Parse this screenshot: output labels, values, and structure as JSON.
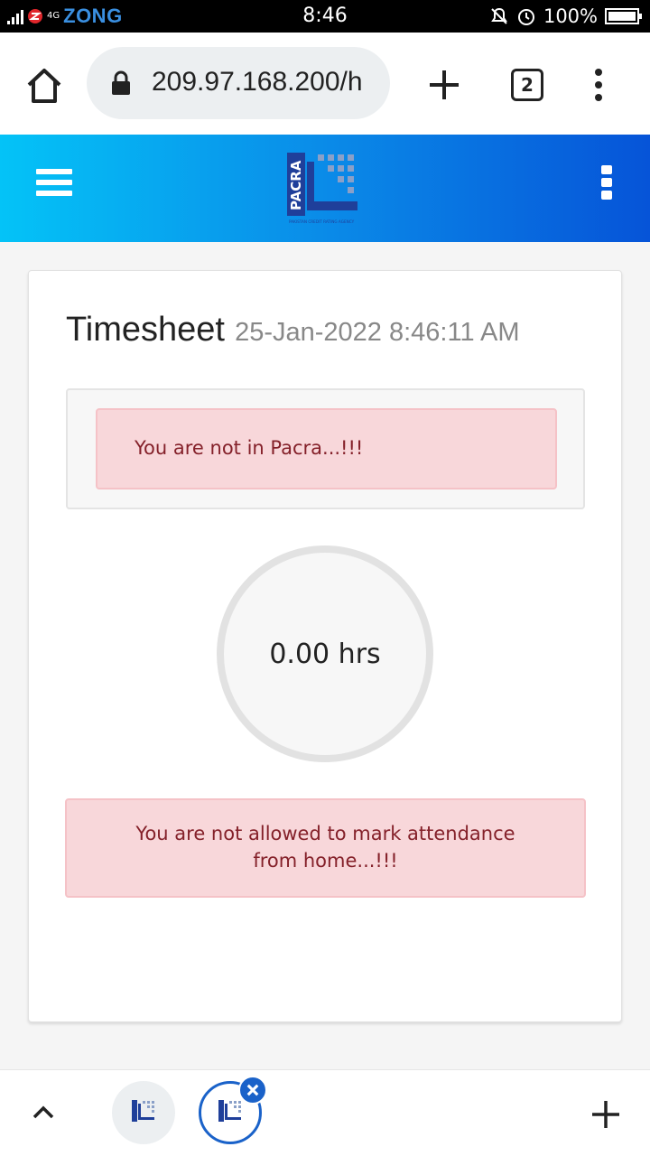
{
  "status_bar": {
    "network": "4G",
    "carrier": "ZONG",
    "time": "8:46",
    "battery": "100%",
    "icons": [
      "signal-icon",
      "mute-bell-icon",
      "alarm-icon",
      "battery-icon"
    ]
  },
  "browser": {
    "url": "209.97.168.200/h",
    "tab_count": "2",
    "icons": [
      "home-icon",
      "lock-icon",
      "plus-icon",
      "overflow-menu-icon"
    ]
  },
  "app_header": {
    "logo_text": "PACRA",
    "logo_subtitle": "PAKISTAN CREDIT RATING AGENCY",
    "icons": [
      "hamburger-menu-icon",
      "kebab-menu-icon"
    ],
    "colors": {
      "gradient_start": "#04c3f7",
      "gradient_end": "#0654d8"
    }
  },
  "card": {
    "title": "Timesheet",
    "timestamp": "25-Jan-2022 8:46:11 AM",
    "location_alert": "You are not in Pacra...!!!",
    "hours": "0.00 hrs",
    "attendance_alert": "You are not allowed to mark attendance from home...!!!",
    "colors": {
      "alert_bg": "#f8d7da",
      "alert_text": "#842029"
    }
  },
  "bottom_bar": {
    "icons": [
      "chevron-up-icon",
      "tab-thumbnail",
      "tab-thumbnail-active",
      "close-tab-icon",
      "new-tab-plus-icon"
    ]
  }
}
